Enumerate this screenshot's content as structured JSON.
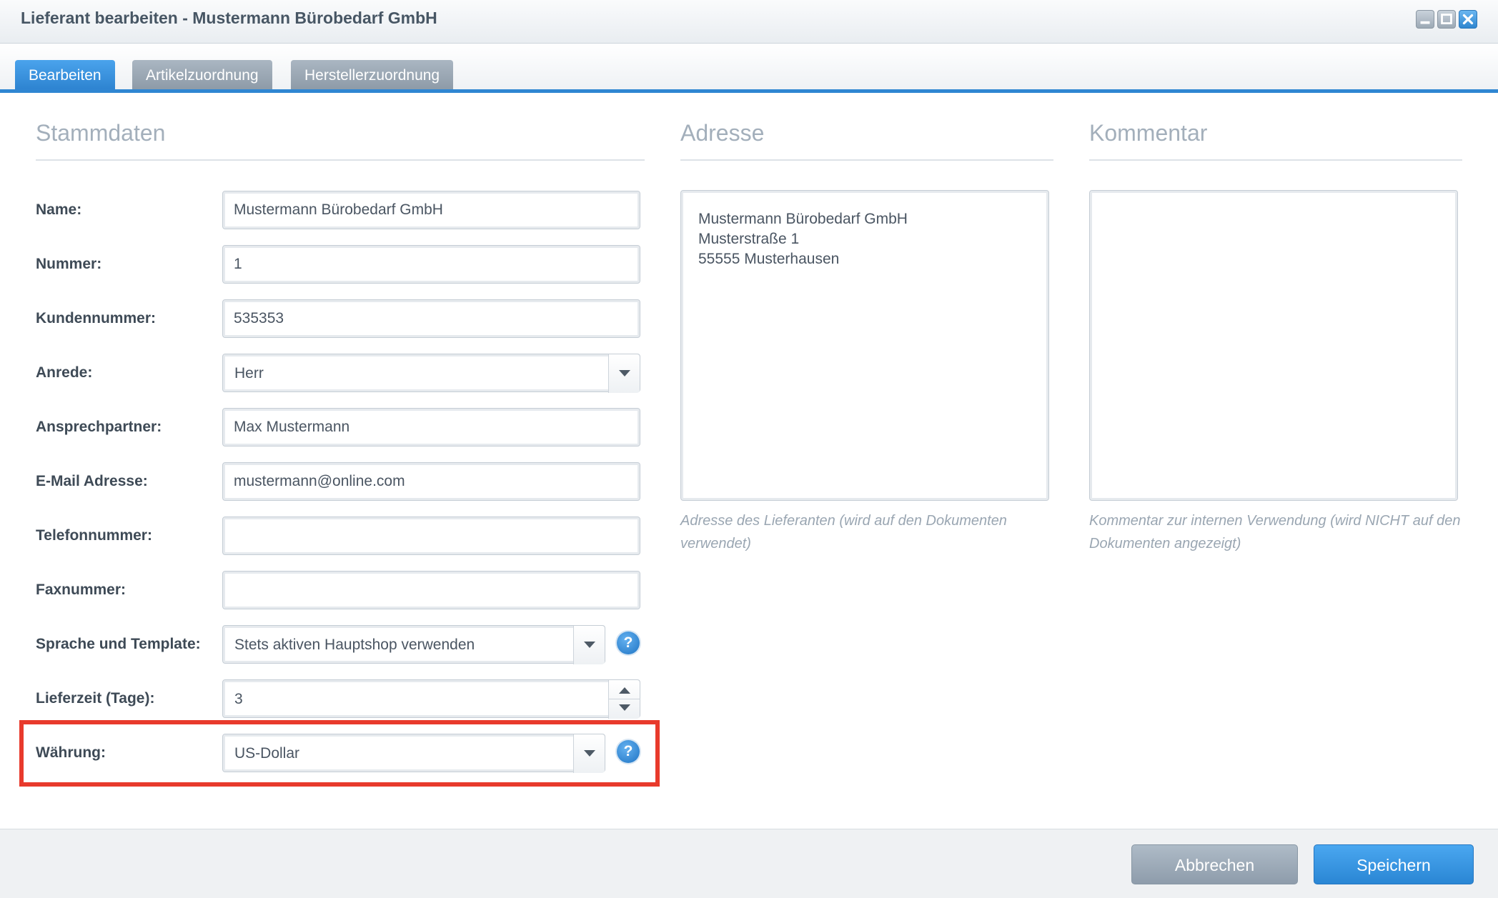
{
  "window": {
    "title": "Lieferant bearbeiten - Mustermann Bürobedarf GmbH",
    "controls": [
      "minimize-icon",
      "maximize-icon",
      "close-icon"
    ],
    "accent_color": "#2f86d2"
  },
  "tabs": [
    {
      "label": "Bearbeiten",
      "active": true
    },
    {
      "label": "Artikelzuordnung",
      "active": false
    },
    {
      "label": "Herstellerzuordnung",
      "active": false
    }
  ],
  "stammdaten": {
    "title": "Stammdaten",
    "fields": {
      "name": {
        "label": "Name:",
        "value": "Mustermann Bürobedarf GmbH"
      },
      "nummer": {
        "label": "Nummer:",
        "value": "1"
      },
      "kundennummer": {
        "label": "Kundennummer:",
        "value": "535353"
      },
      "anrede": {
        "label": "Anrede:",
        "value": "Herr"
      },
      "ansprechpartner": {
        "label": "Ansprechpartner:",
        "value": "Max Mustermann"
      },
      "email": {
        "label": "E-Mail Adresse:",
        "value": "mustermann@online.com"
      },
      "telefon": {
        "label": "Telefonnummer:",
        "value": ""
      },
      "fax": {
        "label": "Faxnummer:",
        "value": ""
      },
      "sprache": {
        "label": "Sprache und Template:",
        "value": "Stets aktiven Hauptshop verwenden"
      },
      "lieferzeit": {
        "label": "Lieferzeit (Tage):",
        "value": "3"
      },
      "waehrung": {
        "label": "Währung:",
        "value": "US-Dollar"
      }
    },
    "highlight_color": "#e83a2c"
  },
  "adresse": {
    "title": "Adresse",
    "lines": [
      "Mustermann Bürobedarf GmbH",
      "Musterstraße 1",
      "55555 Musterhausen"
    ],
    "hint": "Adresse des Lieferanten (wird auf den Dokumenten verwendet)"
  },
  "kommentar": {
    "title": "Kommentar",
    "value": "",
    "hint": "Kommentar zur internen Verwendung (wird NICHT auf den Dokumenten angezeigt)"
  },
  "footer": {
    "cancel_label": "Abbrechen",
    "save_label": "Speichern"
  },
  "help_glyph": "?"
}
